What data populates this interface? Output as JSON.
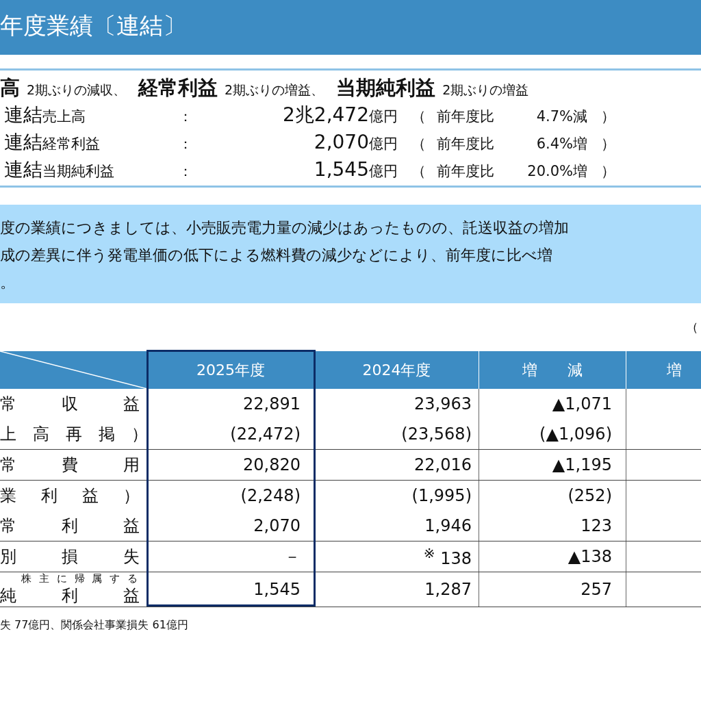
{
  "banner": {
    "title": "年度業績〔連結〕"
  },
  "summary": {
    "headline": [
      {
        "term": "高",
        "note": "2期ぶりの減収、"
      },
      {
        "term": "経常利益",
        "note": "2期ぶりの増益、"
      },
      {
        "term": "当期純利益",
        "note": "2期ぶりの増益"
      }
    ],
    "rows": [
      {
        "prefix": "連結",
        "item": "売上高",
        "colon": "：",
        "amount": "2兆2,472",
        "unit": "億円",
        "open": "（",
        "compare_label": "前年度比",
        "change": "4.7%減",
        "close": "）"
      },
      {
        "prefix": "連結",
        "item": "経常利益",
        "colon": "：",
        "amount": "2,070",
        "unit": "億円",
        "open": "（",
        "compare_label": "前年度比",
        "change": "6.4%増",
        "close": "）"
      },
      {
        "prefix": "連結",
        "item": "当期純利益",
        "colon": "：",
        "amount": "1,545",
        "unit": "億円",
        "open": "（",
        "compare_label": "前年度比",
        "change": "20.0%増",
        "close": "）"
      }
    ]
  },
  "commentary": [
    "度の業績につきましては、小売販売電力量の減少はあったものの、託送収益の増加",
    "成の差異に伴う発電単価の低下による燃料費の減少などにより、前年度に比べ増",
    "。"
  ],
  "unit_note": "（",
  "table": {
    "columns": [
      "2025年度",
      "2024年度",
      "増　　減",
      "増"
    ],
    "groups": [
      {
        "lines": [
          {
            "label": "常　収　益",
            "values": [
              "22,891",
              "23,963",
              "▲1,071"
            ]
          },
          {
            "label": "上　高　再　掲　）",
            "values": [
              "(22,472)",
              "(23,568)",
              "(▲1,096)"
            ]
          }
        ]
      },
      {
        "lines": [
          {
            "label": "常　費　用",
            "values": [
              "20,820",
              "22,016",
              "▲1,195"
            ]
          }
        ]
      },
      {
        "lines": [
          {
            "label": "業　利　益　）",
            "values": [
              "(2,248)",
              "(1,995)",
              "(252)"
            ]
          },
          {
            "label": "常　利　益",
            "values": [
              "2,070",
              "1,946",
              "123"
            ]
          }
        ]
      },
      {
        "lines": [
          {
            "label": "別　損　失",
            "values": [
              "－",
              "$^{※}$ 138",
              "▲138"
            ]
          }
        ]
      },
      {
        "lines": [
          {
            "label_note": "株 主 に 帰 属 す る",
            "label": "純　利　益",
            "values": [
              "1,545",
              "1,287",
              "257"
            ]
          }
        ]
      }
    ]
  },
  "footnote": "失 77億円、関係会社事業損失 61億円"
}
